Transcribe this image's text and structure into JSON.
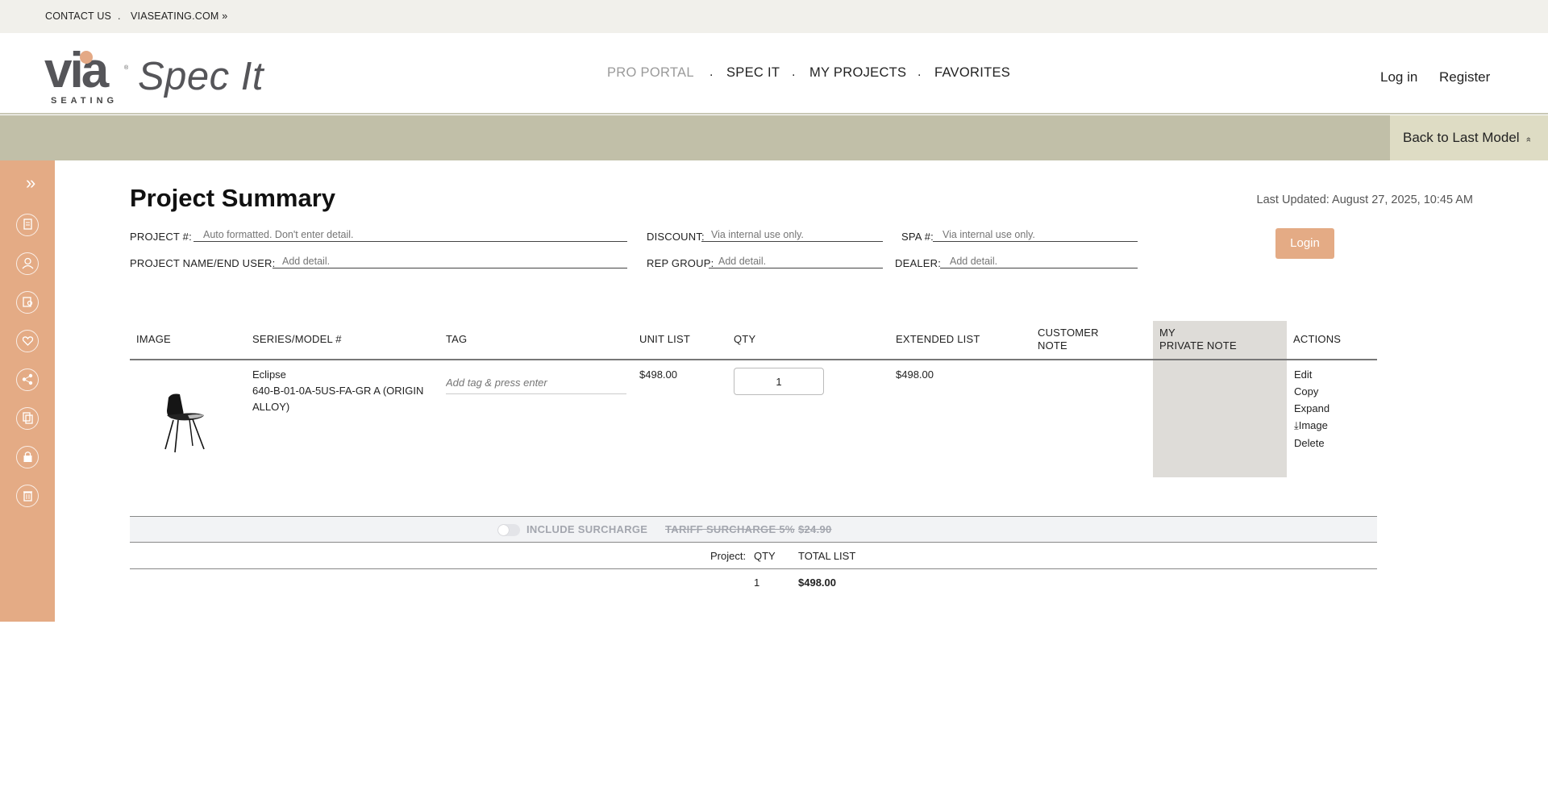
{
  "topbar": {
    "contact": "CONTACT US",
    "sep": ".",
    "site": "VIASEATING.COM »"
  },
  "header": {
    "logo_word": "via",
    "logo_sub": "SEATING",
    "logo_reg": "®",
    "app_name": "Spec It",
    "nav": [
      {
        "label": "PRO PORTAL"
      },
      {
        "label": "SPEC IT"
      },
      {
        "label": "MY PROJECTS"
      },
      {
        "label": "FAVORITES"
      }
    ],
    "nav_sep": ".",
    "login": "Log in",
    "register": "Register"
  },
  "band": {
    "back_label": "Back to Last Model",
    "back_chev": "»"
  },
  "sidebar": {
    "expand": "»",
    "icons": [
      "project-icon",
      "user-icon",
      "search-icon",
      "heart-icon",
      "share-icon",
      "copy-icon",
      "lock-icon",
      "trash-icon"
    ]
  },
  "summary": {
    "title": "Project Summary",
    "last_updated": "Last Updated: August 27, 2025, 10:45 AM",
    "login_button": "Login",
    "fields": {
      "project_no_label": "PROJECT #:",
      "project_no_placeholder": "Auto formatted. Don't enter detail.",
      "discount_label": "DISCOUNT:",
      "discount_placeholder": "Via internal use only.",
      "spa_label": "SPA #:",
      "spa_placeholder": "Via internal use only.",
      "name_label": "PROJECT NAME/END USER:",
      "name_placeholder": "Add detail.",
      "rep_label": "REP GROUP:",
      "rep_placeholder": "Add detail.",
      "dealer_label": "DEALER:",
      "dealer_placeholder": "Add detail."
    }
  },
  "table": {
    "headers": {
      "image": "IMAGE",
      "series": "SERIES/MODEL #",
      "tag": "TAG",
      "unit_list": "UNIT LIST",
      "qty": "QTY",
      "extended": "EXTENDED LIST",
      "customer_note_1": "CUSTOMER",
      "customer_note_2": "NOTE",
      "private_note_1": "MY",
      "private_note_2": "PRIVATE NOTE",
      "actions": "ACTIONS"
    },
    "rows": [
      {
        "series": "Eclipse",
        "model_line1": "640-B-01-0A-5US-FA-GR A (ORIGIN",
        "model_line2": "ALLOY)",
        "tag_placeholder": "Add tag & press enter",
        "unit_list": "$498.00",
        "qty": "1",
        "extended": "$498.00",
        "actions": {
          "edit": "Edit",
          "copy": "Copy",
          "expand": "Expand",
          "image": "⤓Image",
          "delete": "Delete"
        }
      }
    ]
  },
  "surcharge": {
    "include_label": "INCLUDE SURCHARGE",
    "tariff_label": "TARIFF SURCHARGE 5%",
    "tariff_amount": "$24.90",
    "enabled": false
  },
  "totals": {
    "project_label": "Project:",
    "qty_label": "QTY",
    "total_label": "TOTAL LIST",
    "qty_value": "1",
    "total_value": "$498.00"
  }
}
